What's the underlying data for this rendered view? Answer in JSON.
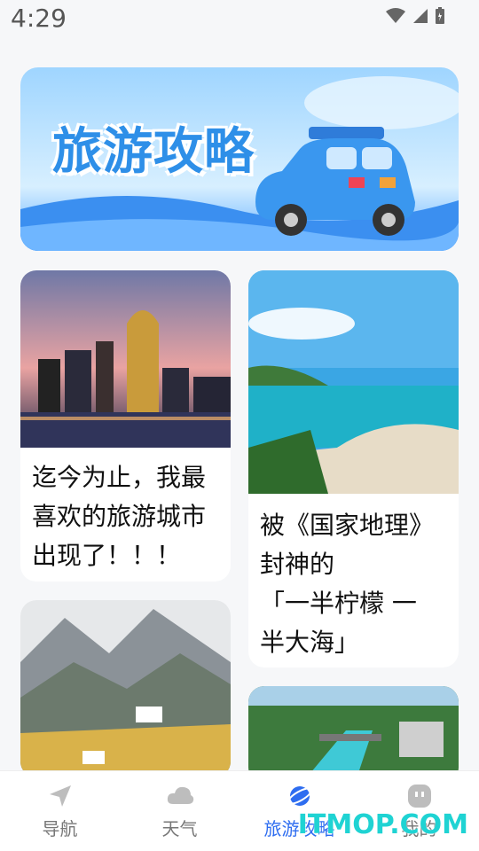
{
  "status": {
    "time": "4:29"
  },
  "banner": {
    "title": "旅游攻略"
  },
  "cards": [
    {
      "text": "迄今为止，我最\n喜欢的旅游城市\n出现了！！！"
    },
    {
      "text": "被《国家地理》\n封神的\n「一半柠檬 一\n半大海」"
    }
  ],
  "nav": {
    "items": [
      {
        "label": "导航",
        "icon": "navigation-arrow-icon"
      },
      {
        "label": "天气",
        "icon": "cloud-icon"
      },
      {
        "label": "旅游攻略",
        "icon": "planet-icon",
        "active": true
      },
      {
        "label": "我的",
        "icon": "profile-icon"
      }
    ]
  },
  "watermark": "ITMOP.COM",
  "colors": {
    "accent": "#2e6df0",
    "inactive": "#777777",
    "banner_blue": "#2e8fe8"
  }
}
